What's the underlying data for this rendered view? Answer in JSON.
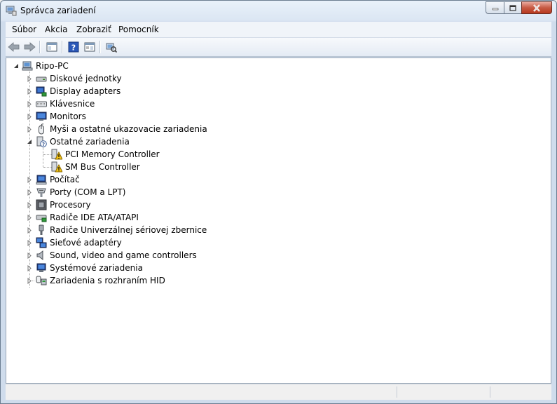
{
  "window": {
    "title": "Správca zariadení"
  },
  "menu": [
    {
      "label": "Súbor"
    },
    {
      "label": "Akcia"
    },
    {
      "label": "Zobraziť"
    },
    {
      "label": "Pomocník"
    }
  ],
  "toolbar": {
    "buttons": [
      {
        "name": "back-icon"
      },
      {
        "name": "forward-icon"
      },
      {
        "name": "show-hide-console-tree-icon"
      },
      {
        "name": "help-icon"
      },
      {
        "name": "properties-icon"
      },
      {
        "name": "scan-hardware-icon"
      }
    ]
  },
  "tree": {
    "root": {
      "label": "Ripo-PC",
      "expanded": true,
      "icon": "computer-icon"
    },
    "items": [
      {
        "label": "Diskové jednotky",
        "icon": "disk-drive-icon",
        "expanded": false
      },
      {
        "label": "Display adapters",
        "icon": "display-adapter-icon",
        "expanded": false
      },
      {
        "label": "Klávesnice",
        "icon": "keyboard-icon",
        "expanded": false
      },
      {
        "label": "Monitors",
        "icon": "monitor-icon",
        "expanded": false
      },
      {
        "label": "Myši a ostatné ukazovacie zariadenia",
        "icon": "mouse-icon",
        "expanded": false
      },
      {
        "label": "Ostatné zariadenia",
        "icon": "unknown-device-icon",
        "expanded": true,
        "children": [
          {
            "label": "PCI Memory Controller",
            "icon": "warning-device-icon"
          },
          {
            "label": "SM Bus Controller",
            "icon": "warning-device-icon"
          }
        ]
      },
      {
        "label": "Počítač",
        "icon": "computer-icon",
        "expanded": false
      },
      {
        "label": "Porty (COM a LPT)",
        "icon": "port-icon",
        "expanded": false
      },
      {
        "label": "Procesory",
        "icon": "processor-icon",
        "expanded": false
      },
      {
        "label": "Radiče IDE ATA/ATAPI",
        "icon": "ide-controller-icon",
        "expanded": false
      },
      {
        "label": "Radiče Univerzálnej sériovej zbernice",
        "icon": "usb-icon",
        "expanded": false
      },
      {
        "label": "Sieťové adaptéry",
        "icon": "network-adapter-icon",
        "expanded": false
      },
      {
        "label": "Sound, video and game controllers",
        "icon": "sound-icon",
        "expanded": false
      },
      {
        "label": "Systémové zariadenia",
        "icon": "system-device-icon",
        "expanded": false
      },
      {
        "label": "Zariadenia s rozhraním HID",
        "icon": "hid-icon",
        "expanded": false
      }
    ]
  },
  "statusbar": {
    "text": ""
  }
}
